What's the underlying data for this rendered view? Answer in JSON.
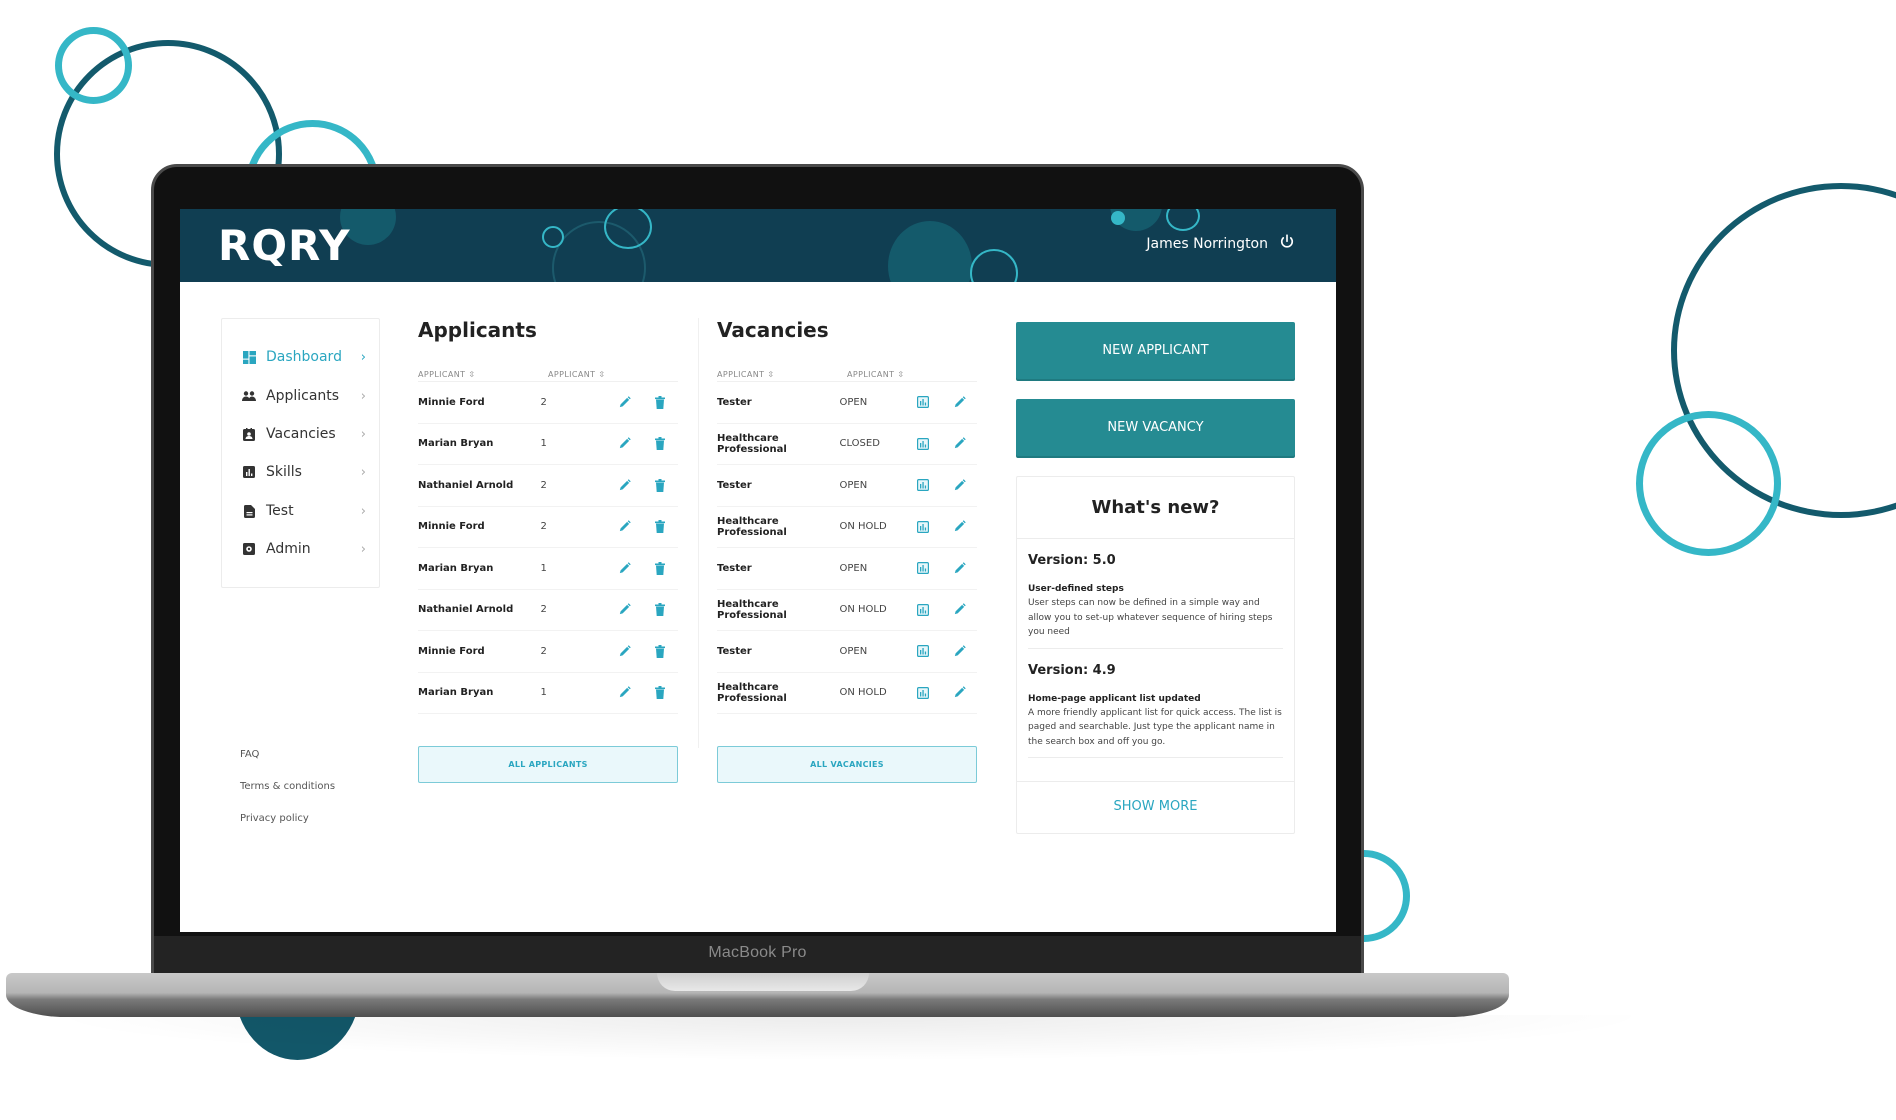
{
  "device": {
    "label": "MacBook Pro"
  },
  "app": {
    "logo": "RQRY",
    "user_name": "James Norrington",
    "colors": {
      "header": "#103e52",
      "accent": "#2aa6c0",
      "primary_button": "#258b92",
      "open": "#6cc24a",
      "on_hold": "#f0a43a"
    }
  },
  "sidebar": {
    "items": [
      {
        "label": "Dashboard",
        "icon": "dashboard-icon",
        "active": true
      },
      {
        "label": "Applicants",
        "icon": "people-icon"
      },
      {
        "label": "Vacancies",
        "icon": "contact-card-icon"
      },
      {
        "label": "Skills",
        "icon": "bar-chart-icon"
      },
      {
        "label": "Test",
        "icon": "document-icon"
      },
      {
        "label": "Admin",
        "icon": "settings-box-icon"
      }
    ],
    "footer_links": [
      "FAQ",
      "Terms & conditions",
      "Privacy policy"
    ]
  },
  "applicants": {
    "title": "Applicants",
    "columns": [
      "APPLICANT",
      "APPLICANT"
    ],
    "rows": [
      {
        "name": "Minnie Ford",
        "count": "2"
      },
      {
        "name": "Marian Bryan",
        "count": "1"
      },
      {
        "name": "Nathaniel Arnold",
        "count": "2"
      },
      {
        "name": "Minnie Ford",
        "count": "2"
      },
      {
        "name": "Marian Bryan",
        "count": "1"
      },
      {
        "name": "Nathaniel Arnold",
        "count": "2"
      },
      {
        "name": "Minnie Ford",
        "count": "2"
      },
      {
        "name": "Marian Bryan",
        "count": "1"
      }
    ],
    "all_button": "ALL APPLICANTS"
  },
  "vacancies": {
    "title": "Vacancies",
    "columns": [
      "APPLICANT",
      "APPLICANT"
    ],
    "rows": [
      {
        "title": "Tester",
        "status": "OPEN"
      },
      {
        "title": "Healthcare Professional",
        "status": "CLOSED"
      },
      {
        "title": "Tester",
        "status": "OPEN"
      },
      {
        "title": "Healthcare Professional",
        "status": "ON HOLD"
      },
      {
        "title": "Tester",
        "status": "OPEN"
      },
      {
        "title": "Healthcare Professional",
        "status": "ON HOLD"
      },
      {
        "title": "Tester",
        "status": "OPEN"
      },
      {
        "title": "Healthcare Professional",
        "status": "ON HOLD"
      }
    ],
    "all_button": "ALL VACANCIES"
  },
  "actions": {
    "new_applicant": "NEW APPLICANT",
    "new_vacancy": "NEW VACANCY"
  },
  "whats_new": {
    "title": "What's new?",
    "items": [
      {
        "version": "Version: 5.0",
        "title": "User-defined steps",
        "description": "User steps can now be defined in a simple way and allow you to set-up whatever sequence of hiring steps you need"
      },
      {
        "version": "Version: 4.9",
        "title": "Home-page applicant list updated",
        "description": "A more friendly applicant list for quick access. The list is paged and searchable. Just type the applicant name in the search box and off you go."
      }
    ],
    "show_more": "SHOW MORE"
  }
}
